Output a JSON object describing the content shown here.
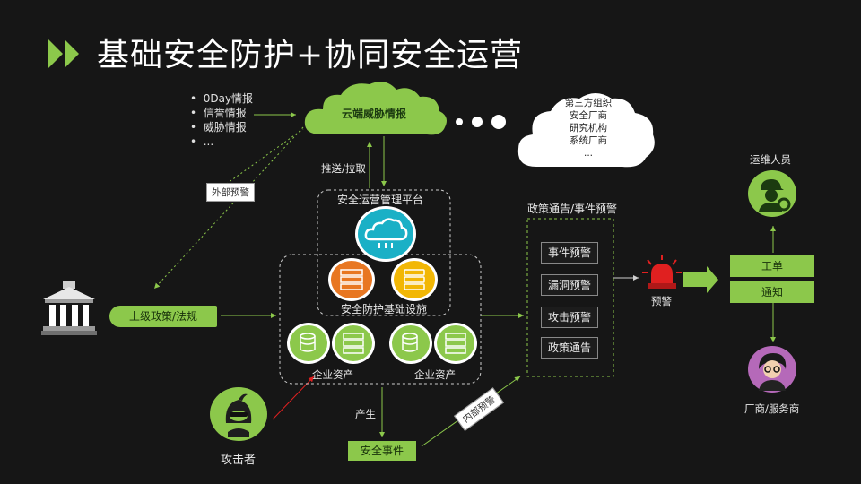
{
  "title": "基础安全防护+协同安全运营",
  "intel_bullets": [
    "0Day情报",
    "信誉情报",
    "威胁情报",
    "..."
  ],
  "cloud_label": "云端威胁情报",
  "third_party_lines": [
    "第三方组织",
    "安全厂商",
    "研究机构",
    "系统厂商",
    "..."
  ],
  "push_pull_label": "推送/拉取",
  "external_warning_label": "外部预警",
  "platform_label": "安全运营管理平台",
  "infra_label": "安全防护基础设施",
  "asset_label_left": "企业资产",
  "asset_label_right": "企业资产",
  "policy_label": "上级政策/法规",
  "policy_panel_title": "政策通告/事件预警",
  "alerts": [
    "事件预警",
    "漏洞预警",
    "攻击预警",
    "政策通告"
  ],
  "alarm_label": "预警",
  "ops_label": "运维人员",
  "work_order_label": "工单",
  "notify_label": "通知",
  "vendor_label": "厂商/服务商",
  "attacker_label": "攻击者",
  "produce_label": "产生",
  "security_event_label": "安全事件",
  "internal_warning_label": "内部预警",
  "colors": {
    "green": "#8cc84b",
    "teal": "#1ab0c6",
    "orange": "#e87722",
    "yellow": "#f2b705",
    "red": "#e02020"
  }
}
